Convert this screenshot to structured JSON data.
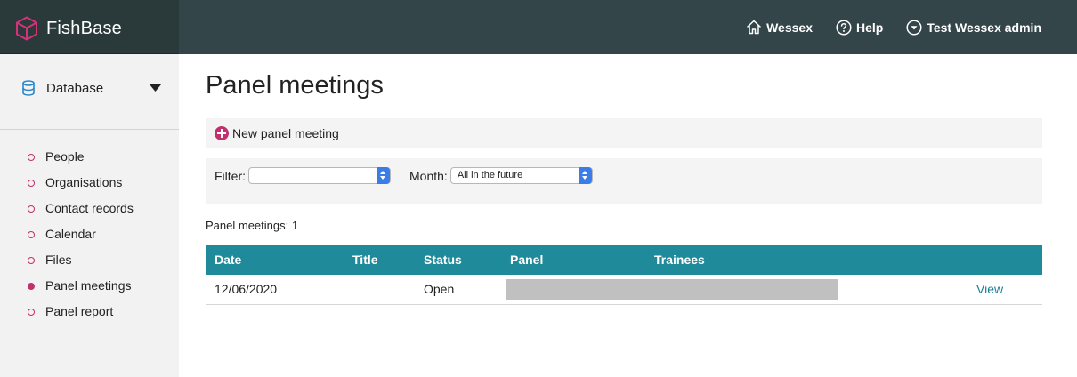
{
  "brand": {
    "name": "FishBase",
    "logo_icon": "cube-icon"
  },
  "topnav": {
    "home_label": "Wessex",
    "help_label": "Help",
    "user_label": "Test Wessex admin"
  },
  "sidebar": {
    "database_label": "Database",
    "items": [
      {
        "label": "People",
        "active": false
      },
      {
        "label": "Organisations",
        "active": false
      },
      {
        "label": "Contact records",
        "active": false
      },
      {
        "label": "Calendar",
        "active": false
      },
      {
        "label": "Files",
        "active": false
      },
      {
        "label": "Panel meetings",
        "active": true
      },
      {
        "label": "Panel report",
        "active": false
      }
    ]
  },
  "main": {
    "title": "Panel meetings",
    "new_button_label": "New panel meeting",
    "filter": {
      "label": "Filter:",
      "value": ""
    },
    "month": {
      "label": "Month:",
      "value": "All in the future"
    },
    "count_text": "Panel meetings: 1",
    "table": {
      "columns": [
        "Date",
        "Title",
        "Status",
        "Panel",
        "Trainees"
      ],
      "rows": [
        {
          "date": "12/06/2020",
          "title": "",
          "status": "Open",
          "panel": "",
          "trainees": "",
          "action": "View"
        }
      ]
    }
  },
  "colors": {
    "accent": "#c2306e",
    "header_bg": "#34454a",
    "brand_bg": "#2a3a3a",
    "table_header": "#1f8a9a",
    "link": "#1d7f93"
  }
}
